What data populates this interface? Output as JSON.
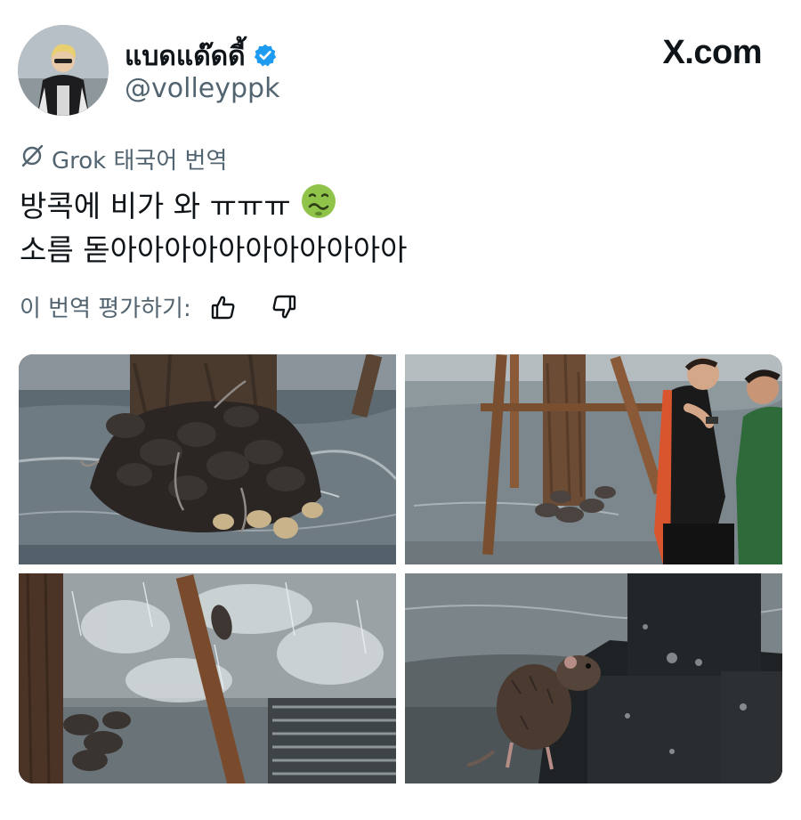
{
  "author": {
    "display_name": "แบดแด๊ดดี้",
    "handle": "@volleyppk",
    "verified": true,
    "verified_color": "#1d9bf0",
    "avatar_icon": "avatar-photo"
  },
  "brand": {
    "label": "X.com"
  },
  "translation": {
    "icon": "translate-icon",
    "label": "Grok 태국어 번역"
  },
  "tweet": {
    "line1": "방콕에 비가 와 ㅠㅠㅠ",
    "line1_emoji": "nauseated-face-emoji",
    "line2": "소름 돋아아아아아아아아아아아"
  },
  "rating": {
    "label": "이 번역 평가하기:",
    "like_icon": "thumbs-up-icon",
    "dislike_icon": "thumbs-down-icon"
  },
  "media": [
    {
      "name": "photo-rats-on-tree-flood"
    },
    {
      "name": "photo-people-looking-at-rats"
    },
    {
      "name": "photo-rats-climbing-pole-rain"
    },
    {
      "name": "photo-wet-rat-by-post"
    }
  ],
  "colors": {
    "text": "#0f1419",
    "muted": "#536471"
  }
}
